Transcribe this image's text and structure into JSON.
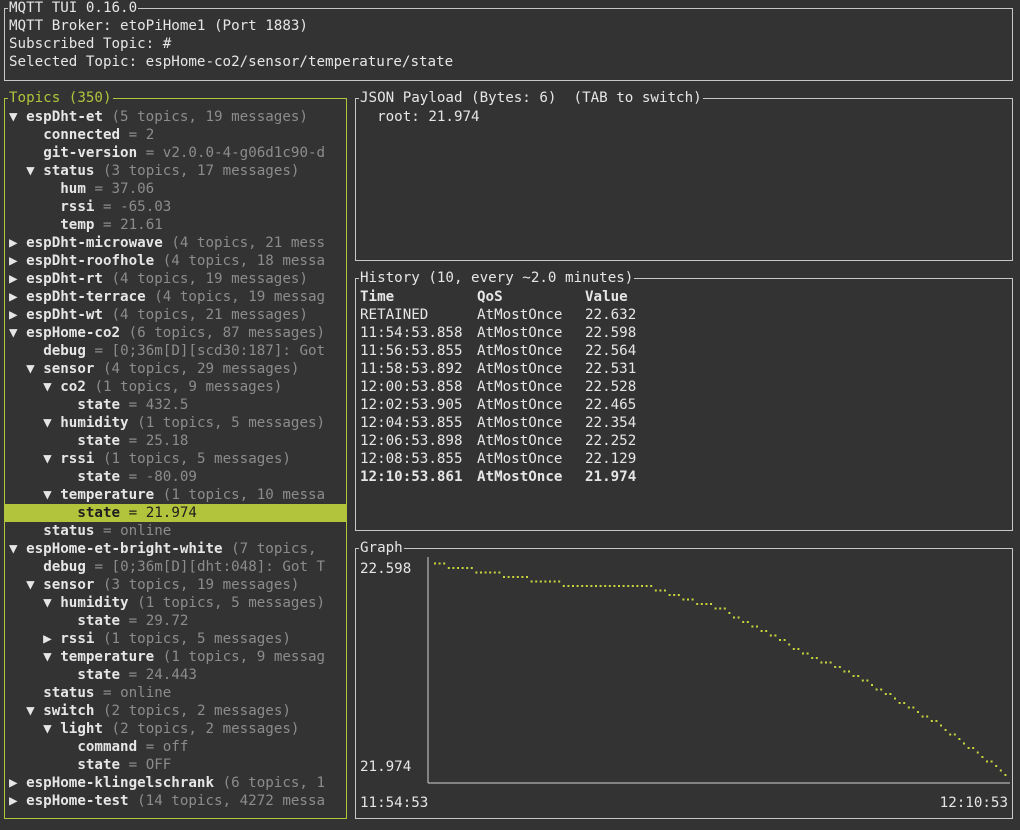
{
  "header": {
    "title": "MQTT TUI 0.16.0",
    "broker": "MQTT Broker: etoPiHome1 (Port 1883)",
    "subscribed": "Subscribed Topic: #",
    "selected": "Selected Topic: espHome-co2/sensor/temperature/state"
  },
  "topics": {
    "title": "Topics (350)",
    "rows": [
      {
        "indent": 0,
        "arrow": "▼",
        "name": "espDht-et",
        "info": "(5 topics, 19 messages)"
      },
      {
        "indent": 1,
        "arrow": "",
        "name": "connected",
        "value": "= 2"
      },
      {
        "indent": 1,
        "arrow": "",
        "name": "git-version",
        "value": "= v2.0.0-4-g06d1c90-d"
      },
      {
        "indent": 1,
        "arrow": "▼",
        "name": "status",
        "info": "(3 topics, 17 messages)"
      },
      {
        "indent": 2,
        "arrow": "",
        "name": "hum",
        "value": "= 37.06"
      },
      {
        "indent": 2,
        "arrow": "",
        "name": "rssi",
        "value": "= -65.03"
      },
      {
        "indent": 2,
        "arrow": "",
        "name": "temp",
        "value": "= 21.61"
      },
      {
        "indent": 0,
        "arrow": "▶",
        "name": "espDht-microwave",
        "info": "(4 topics, 21 mess"
      },
      {
        "indent": 0,
        "arrow": "▶",
        "name": "espDht-roofhole",
        "info": "(4 topics, 18 messa"
      },
      {
        "indent": 0,
        "arrow": "▶",
        "name": "espDht-rt",
        "info": "(4 topics, 19 messages)"
      },
      {
        "indent": 0,
        "arrow": "▶",
        "name": "espDht-terrace",
        "info": "(4 topics, 19 messag"
      },
      {
        "indent": 0,
        "arrow": "▶",
        "name": "espDht-wt",
        "info": "(4 topics, 21 messages)"
      },
      {
        "indent": 0,
        "arrow": "▼",
        "name": "espHome-co2",
        "info": "(6 topics, 87 messages)"
      },
      {
        "indent": 1,
        "arrow": "",
        "name": "debug",
        "value": "= [0;36m[D][scd30:187]: Got"
      },
      {
        "indent": 1,
        "arrow": "▼",
        "name": "sensor",
        "info": "(4 topics, 29 messages)"
      },
      {
        "indent": 2,
        "arrow": "▼",
        "name": "co2",
        "info": "(1 topics, 9 messages)"
      },
      {
        "indent": 3,
        "arrow": "",
        "name": "state",
        "value": "= 432.5"
      },
      {
        "indent": 2,
        "arrow": "▼",
        "name": "humidity",
        "info": "(1 topics, 5 messages)"
      },
      {
        "indent": 3,
        "arrow": "",
        "name": "state",
        "value": "= 25.18"
      },
      {
        "indent": 2,
        "arrow": "▼",
        "name": "rssi",
        "info": "(1 topics, 5 messages)"
      },
      {
        "indent": 3,
        "arrow": "",
        "name": "state",
        "value": "= -80.09"
      },
      {
        "indent": 2,
        "arrow": "▼",
        "name": "temperature",
        "info": "(1 topics, 10 messa"
      },
      {
        "indent": 3,
        "arrow": "",
        "name": "state",
        "value": "= 21.974",
        "selected": true
      },
      {
        "indent": 1,
        "arrow": "",
        "name": "status",
        "value": "= online"
      },
      {
        "indent": 0,
        "arrow": "▼",
        "name": "espHome-et-bright-white",
        "info": "(7 topics,"
      },
      {
        "indent": 1,
        "arrow": "",
        "name": "debug",
        "value": "= [0;36m[D][dht:048]: Got T"
      },
      {
        "indent": 1,
        "arrow": "▼",
        "name": "sensor",
        "info": "(3 topics, 19 messages)"
      },
      {
        "indent": 2,
        "arrow": "▼",
        "name": "humidity",
        "info": "(1 topics, 5 messages)"
      },
      {
        "indent": 3,
        "arrow": "",
        "name": "state",
        "value": "= 29.72"
      },
      {
        "indent": 2,
        "arrow": "▶",
        "name": "rssi",
        "info": "(1 topics, 5 messages)"
      },
      {
        "indent": 2,
        "arrow": "▼",
        "name": "temperature",
        "info": "(1 topics, 9 messag"
      },
      {
        "indent": 3,
        "arrow": "",
        "name": "state",
        "value": "= 24.443"
      },
      {
        "indent": 1,
        "arrow": "",
        "name": "status",
        "value": "= online"
      },
      {
        "indent": 1,
        "arrow": "▼",
        "name": "switch",
        "info": "(2 topics, 2 messages)"
      },
      {
        "indent": 2,
        "arrow": "▼",
        "name": "light",
        "info": "(2 topics, 2 messages)"
      },
      {
        "indent": 3,
        "arrow": "",
        "name": "command",
        "value": "= off"
      },
      {
        "indent": 3,
        "arrow": "",
        "name": "state",
        "value": "= OFF"
      },
      {
        "indent": 0,
        "arrow": "▶",
        "name": "espHome-klingelschrank",
        "info": "(6 topics, 1"
      },
      {
        "indent": 0,
        "arrow": "▶",
        "name": "espHome-test",
        "info": "(14 topics, 4272 messa"
      }
    ]
  },
  "payload": {
    "title": "JSON Payload (Bytes: 6)  (TAB to switch)",
    "content": "  root: 21.974"
  },
  "history": {
    "title": "History (10, every ~2.0 minutes)",
    "columns": [
      "Time",
      "QoS",
      "Value"
    ],
    "rows": [
      [
        "RETAINED",
        "AtMostOnce",
        "22.632"
      ],
      [
        "11:54:53.858",
        "AtMostOnce",
        "22.598"
      ],
      [
        "11:56:53.855",
        "AtMostOnce",
        "22.564"
      ],
      [
        "11:58:53.892",
        "AtMostOnce",
        "22.531"
      ],
      [
        "12:00:53.858",
        "AtMostOnce",
        "22.528"
      ],
      [
        "12:02:53.905",
        "AtMostOnce",
        "22.465"
      ],
      [
        "12:04:53.855",
        "AtMostOnce",
        "22.354"
      ],
      [
        "12:06:53.898",
        "AtMostOnce",
        "22.252"
      ],
      [
        "12:08:53.855",
        "AtMostOnce",
        "22.129"
      ],
      [
        "12:10:53.861",
        "AtMostOnce",
        "21.974"
      ]
    ]
  },
  "graph": {
    "title": "Graph",
    "y_max_label": "22.598",
    "y_min_label": "21.974",
    "x_min_label": "11:54:53",
    "x_max_label": "12:10:53"
  },
  "chart_data": {
    "type": "line",
    "x": [
      "11:54:53",
      "11:56:53",
      "11:58:53",
      "12:00:53",
      "12:02:53",
      "12:04:53",
      "12:06:53",
      "12:08:53",
      "12:10:53"
    ],
    "values": [
      22.598,
      22.564,
      22.531,
      22.528,
      22.465,
      22.354,
      22.252,
      22.129,
      21.974
    ],
    "ylim": [
      21.974,
      22.598
    ],
    "color": "#c8d43c"
  },
  "colors": {
    "accent": "#b2c43c",
    "border": "#c8c8c8",
    "background": "#333333"
  }
}
